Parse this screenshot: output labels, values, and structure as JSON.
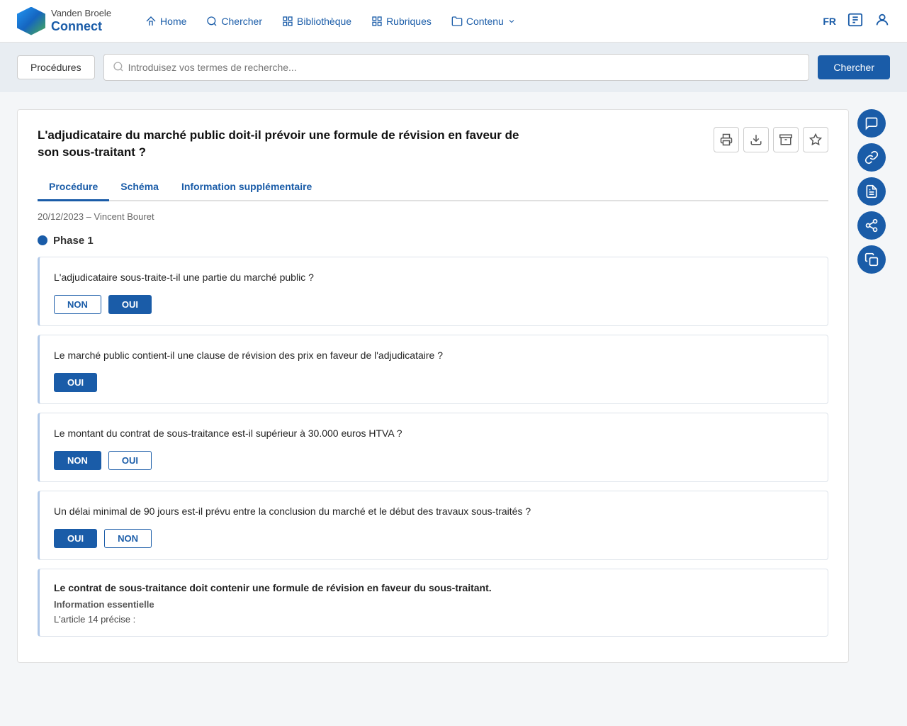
{
  "app": {
    "logo_top": "Vanden Broele",
    "logo_bottom": "Connect"
  },
  "nav": {
    "home_label": "Home",
    "search_label": "Chercher",
    "library_label": "Bibliothèque",
    "rubriques_label": "Rubriques",
    "contenu_label": "Contenu",
    "lang": "FR"
  },
  "search_bar": {
    "tag_label": "Procédures",
    "placeholder": "Introduisez vos termes de recherche...",
    "button_label": "Chercher"
  },
  "article": {
    "title": "L'adjudicataire du marché public doit-il prévoir une formule de révision en faveur de son sous-traitant ?",
    "date_author": "20/12/2023 – Vincent Bouret",
    "tabs": [
      {
        "label": "Procédure",
        "active": true
      },
      {
        "label": "Schéma",
        "active": false
      },
      {
        "label": "Information supplémentaire",
        "active": false
      }
    ],
    "phase_label": "Phase 1",
    "questions": [
      {
        "text": "L'adjudicataire sous-traite-t-il une partie du marché public ?",
        "options": [
          {
            "label": "NON",
            "selected": false
          },
          {
            "label": "OUI",
            "selected": true
          }
        ]
      },
      {
        "text": "Le marché public contient-il une clause de révision des prix en faveur de l'adjudicataire ?",
        "options": [
          {
            "label": "OUI",
            "selected": true
          }
        ]
      },
      {
        "text": "Le montant du contrat de sous-traitance est-il supérieur à  30.000 euros HTVA ?",
        "options": [
          {
            "label": "NON",
            "selected": true
          },
          {
            "label": "OUI",
            "selected": false
          }
        ]
      },
      {
        "text": "Un délai minimal de 90 jours est-il prévu entre la conclusion du marché et le début des travaux sous-traités ?",
        "options": [
          {
            "label": "OUI",
            "selected": true
          },
          {
            "label": "NON",
            "selected": false
          }
        ]
      }
    ],
    "result": {
      "title": "Le contrat de sous-traitance doit contenir une formule de révision en faveur du sous-traitant.",
      "subtitle": "Information essentielle",
      "text": "L'article 14 précise :"
    }
  },
  "side_actions": [
    {
      "icon": "comment-icon",
      "symbol": "💬"
    },
    {
      "icon": "link-icon",
      "symbol": "🔗"
    },
    {
      "icon": "document-icon",
      "symbol": "📄"
    },
    {
      "icon": "chain-icon",
      "symbol": "🔗"
    },
    {
      "icon": "copy-icon",
      "symbol": "📋"
    }
  ],
  "article_actions": [
    {
      "icon": "print-icon",
      "symbol": "🖨"
    },
    {
      "icon": "download-icon",
      "symbol": "⬇"
    },
    {
      "icon": "archive-icon",
      "symbol": "🗄"
    },
    {
      "icon": "star-icon",
      "symbol": "☆"
    }
  ]
}
